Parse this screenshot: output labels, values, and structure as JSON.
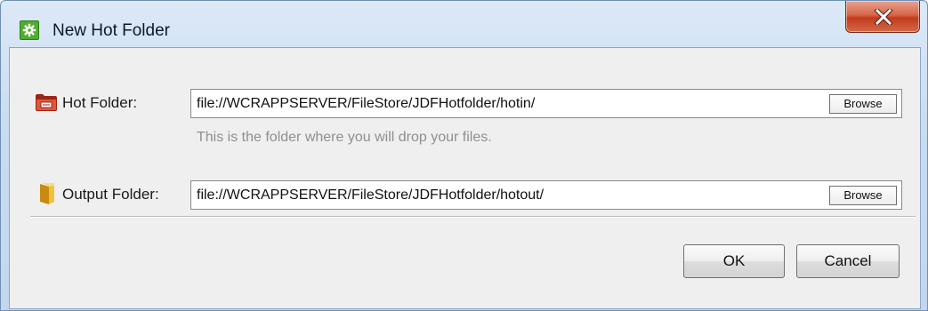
{
  "window": {
    "title": "New Hot Folder",
    "icon": "gear-icon",
    "close_icon": "close-icon"
  },
  "hot_folder": {
    "icon": "red-folder-icon",
    "label": "Hot Folder:",
    "value": "file://WCRAPPSERVER/FileStore/JDFHotfolder/hotin/",
    "browse_label": "Browse",
    "hint": "This is the folder where you will drop your files."
  },
  "output_folder": {
    "icon": "yellow-folder-icon",
    "label": "Output Folder:",
    "value": "file://WCRAPPSERVER/FileStore/JDFHotfolder/hotout/",
    "browse_label": "Browse"
  },
  "actions": {
    "ok_label": "OK",
    "cancel_label": "Cancel"
  },
  "colors": {
    "title_icon_green": "#4fae2b",
    "close_red": "#c33b1c",
    "hint_gray": "#8f8f8f"
  }
}
